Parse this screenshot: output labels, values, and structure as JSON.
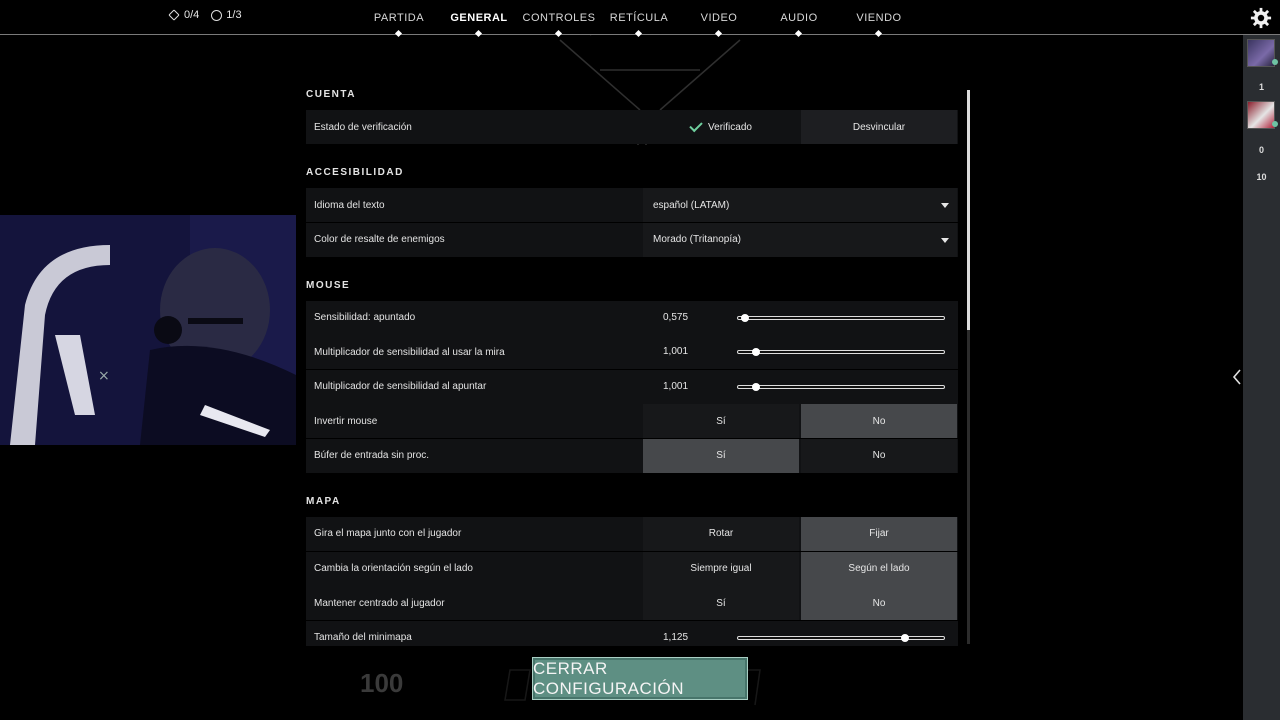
{
  "topbar": {
    "counters": [
      {
        "icon": "diamond-icon",
        "text": "0/4"
      },
      {
        "icon": "plus-circle-icon",
        "text": "1/3"
      }
    ],
    "tabs": [
      {
        "label": "PARTIDA",
        "active": false
      },
      {
        "label": "GENERAL",
        "active": true
      },
      {
        "label": "CONTROLES",
        "active": false
      },
      {
        "label": "RETÍCULA",
        "active": false
      },
      {
        "label": "VIDEO",
        "active": false
      },
      {
        "label": "AUDIO",
        "active": false
      },
      {
        "label": "VIENDO",
        "active": false
      }
    ],
    "settings_icon": "gear-icon"
  },
  "rail": {
    "numbers": [
      "1",
      "0",
      "10"
    ]
  },
  "sections": {
    "cuenta": {
      "title": "CUENTA",
      "verificacion": {
        "label": "Estado de verificación",
        "status": "Verificado",
        "action": "Desvincular"
      }
    },
    "accesibilidad": {
      "title": "ACCESIBILIDAD",
      "idioma": {
        "label": "Idioma del texto",
        "value": "español (LATAM)"
      },
      "color": {
        "label": "Color de resalte de enemigos",
        "value": "Morado (Tritanopía)"
      }
    },
    "mouse": {
      "title": "MOUSE",
      "sens": {
        "label": "Sensibilidad: apuntado",
        "value": "0,575",
        "level": 0.04
      },
      "mira": {
        "label": "Multiplicador de sensibilidad al usar la mira",
        "value": "1,001",
        "level": 0.09
      },
      "apuntar": {
        "label": "Multiplicador de sensibilidad al apuntar",
        "value": "1,001",
        "level": 0.09
      },
      "invertir": {
        "label": "Invertir mouse",
        "opt_a": "Sí",
        "opt_b": "No",
        "selected": "No"
      },
      "bufer": {
        "label": "Búfer de entrada sin proc.",
        "opt_a": "Sí",
        "opt_b": "No",
        "selected": "Sí"
      }
    },
    "mapa": {
      "title": "MAPA",
      "gira": {
        "label": "Gira el mapa junto con el jugador",
        "opt_a": "Rotar",
        "opt_b": "Fijar",
        "selected": "Fijar"
      },
      "orientacion": {
        "label": "Cambia la orientación según el lado",
        "opt_a": "Siempre igual",
        "opt_b": "Según el lado",
        "selected": "Según el lado"
      },
      "centrado": {
        "label": "Mantener centrado al jugador",
        "opt_a": "Sí",
        "opt_b": "No",
        "selected": "No"
      },
      "minimapa": {
        "label": "Tamaño del minimapa",
        "value": "1,125",
        "level": 0.81
      }
    }
  },
  "close_button": "CERRAR CONFIGURACIÓN",
  "hud_text": "100",
  "colors": {
    "accent": "#5e8f83",
    "selected": "#46484b",
    "row": "#111214",
    "check": "#6fcf9e"
  }
}
